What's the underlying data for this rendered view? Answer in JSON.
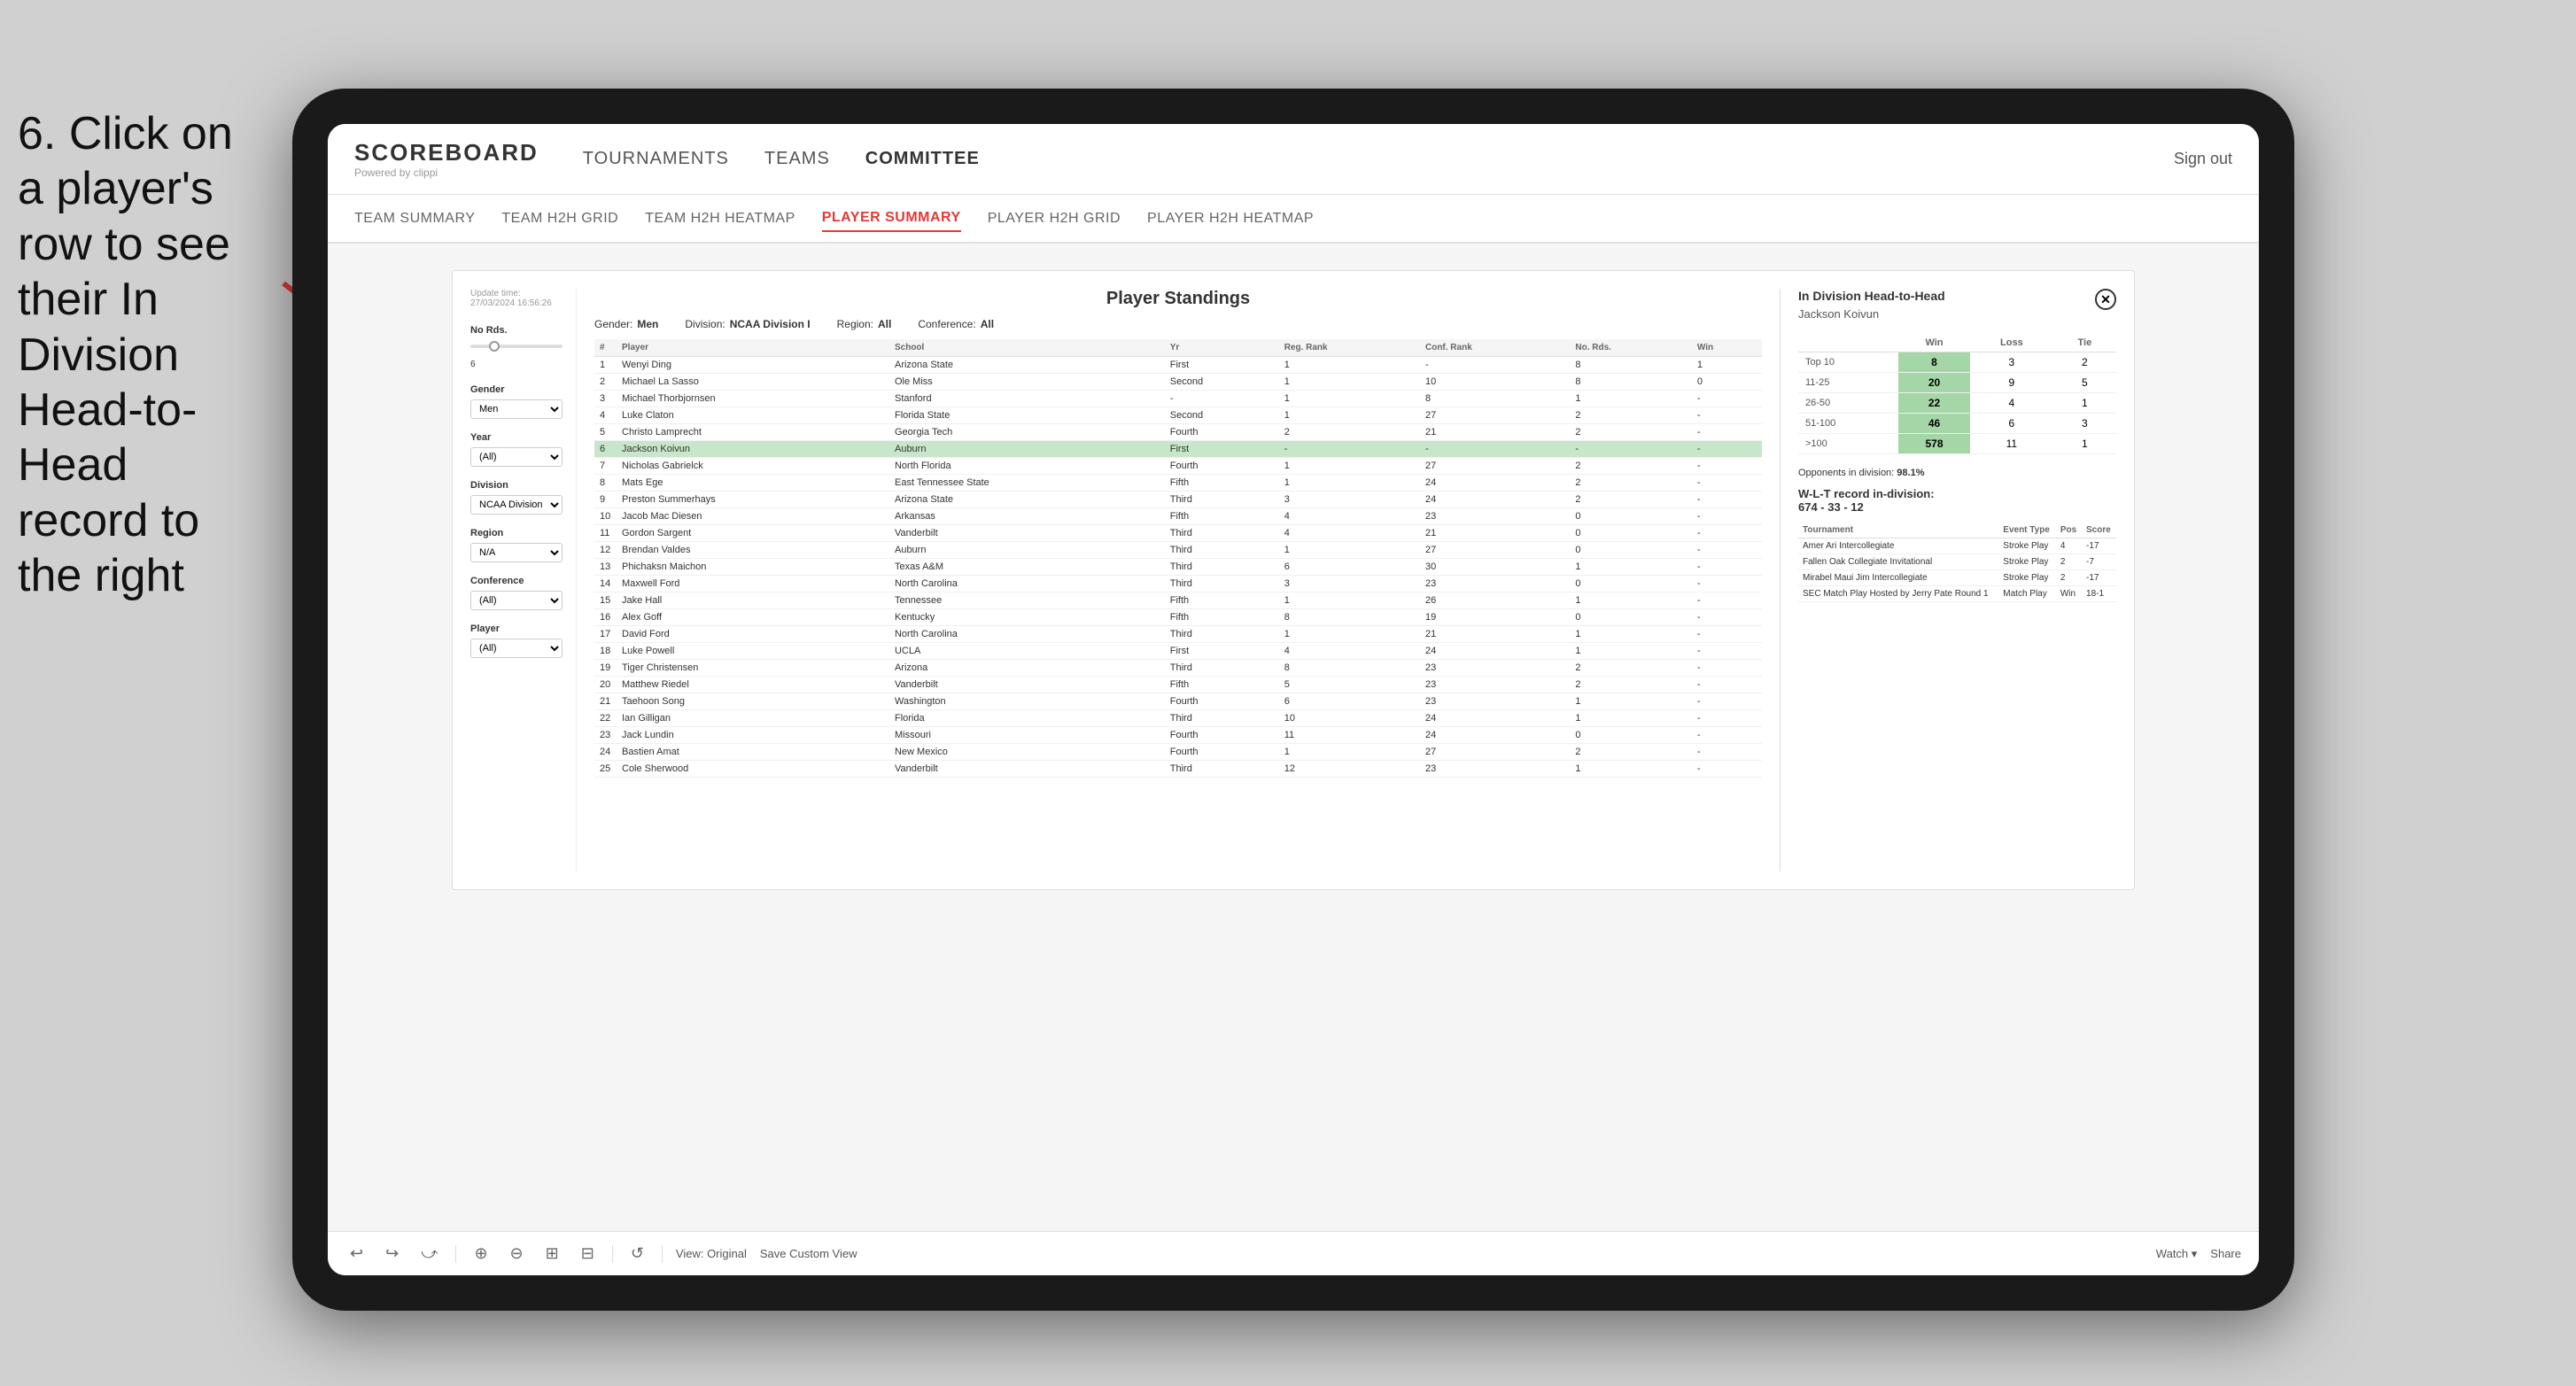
{
  "instruction": {
    "text": "6. Click on a player's row to see their In Division Head-to-Head record to the right"
  },
  "header": {
    "logo": "SCOREBOARD",
    "powered_by": "Powered by clippi",
    "nav": [
      "TOURNAMENTS",
      "TEAMS",
      "COMMITTEE"
    ],
    "sign_out": "Sign out"
  },
  "sub_nav": {
    "items": [
      "TEAM SUMMARY",
      "TEAM H2H GRID",
      "TEAM H2H HEATMAP",
      "PLAYER SUMMARY",
      "PLAYER H2H GRID",
      "PLAYER H2H HEATMAP"
    ],
    "active": "PLAYER SUMMARY"
  },
  "update_time": {
    "label": "Update time:",
    "value": "27/03/2024 16:56:26"
  },
  "filters": {
    "no_rds": {
      "label": "No Rds.",
      "value": "6"
    },
    "gender": {
      "label": "Gender",
      "value": "Men"
    },
    "year": {
      "label": "Year",
      "value": "(All)"
    },
    "division": {
      "label": "Division",
      "value": "NCAA Division I"
    },
    "region": {
      "label": "Region",
      "value": "N/A"
    },
    "conference": {
      "label": "Conference",
      "value": "(All)"
    },
    "player": {
      "label": "Player",
      "value": "(All)"
    }
  },
  "standings": {
    "title": "Player Standings",
    "gender_label": "Gender:",
    "gender_value": "Men",
    "division_label": "Division:",
    "division_value": "NCAA Division I",
    "region_label": "Region:",
    "region_value": "All",
    "conference_label": "Conference:",
    "conference_value": "All",
    "columns": [
      "#",
      "Player",
      "School",
      "Yr",
      "Reg. Rank",
      "Conf. Rank",
      "No. Rds.",
      "Win"
    ],
    "rows": [
      {
        "rank": "1",
        "player": "Wenyi Ding",
        "school": "Arizona State",
        "yr": "First",
        "reg_rank": "1",
        "conf_rank": "-",
        "no_rds": "8",
        "win": "1"
      },
      {
        "rank": "2",
        "player": "Michael La Sasso",
        "school": "Ole Miss",
        "yr": "Second",
        "reg_rank": "1",
        "conf_rank": "10",
        "no_rds": "8",
        "win": "0"
      },
      {
        "rank": "3",
        "player": "Michael Thorbjornsen",
        "school": "Stanford",
        "yr": "-",
        "reg_rank": "1",
        "conf_rank": "8",
        "no_rds": "1",
        "win": "-"
      },
      {
        "rank": "4",
        "player": "Luke Claton",
        "school": "Florida State",
        "yr": "Second",
        "reg_rank": "1",
        "conf_rank": "27",
        "no_rds": "2",
        "win": "-"
      },
      {
        "rank": "5",
        "player": "Christo Lamprecht",
        "school": "Georgia Tech",
        "yr": "Fourth",
        "reg_rank": "2",
        "conf_rank": "21",
        "no_rds": "2",
        "win": "-"
      },
      {
        "rank": "6",
        "player": "Jackson Koivun",
        "school": "Auburn",
        "yr": "First",
        "reg_rank": "-",
        "conf_rank": "-",
        "no_rds": "-",
        "win": "-",
        "highlighted": true
      },
      {
        "rank": "7",
        "player": "Nicholas Gabrielck",
        "school": "North Florida",
        "yr": "Fourth",
        "reg_rank": "1",
        "conf_rank": "27",
        "no_rds": "2",
        "win": "-"
      },
      {
        "rank": "8",
        "player": "Mats Ege",
        "school": "East Tennessee State",
        "yr": "Fifth",
        "reg_rank": "1",
        "conf_rank": "24",
        "no_rds": "2",
        "win": "-"
      },
      {
        "rank": "9",
        "player": "Preston Summerhays",
        "school": "Arizona State",
        "yr": "Third",
        "reg_rank": "3",
        "conf_rank": "24",
        "no_rds": "2",
        "win": "-"
      },
      {
        "rank": "10",
        "player": "Jacob Mac Diesen",
        "school": "Arkansas",
        "yr": "Fifth",
        "reg_rank": "4",
        "conf_rank": "23",
        "no_rds": "0",
        "win": "-"
      },
      {
        "rank": "11",
        "player": "Gordon Sargent",
        "school": "Vanderbilt",
        "yr": "Third",
        "reg_rank": "4",
        "conf_rank": "21",
        "no_rds": "0",
        "win": "-"
      },
      {
        "rank": "12",
        "player": "Brendan Valdes",
        "school": "Auburn",
        "yr": "Third",
        "reg_rank": "1",
        "conf_rank": "27",
        "no_rds": "0",
        "win": "-"
      },
      {
        "rank": "13",
        "player": "Phichaksn Maichon",
        "school": "Texas A&M",
        "yr": "Third",
        "reg_rank": "6",
        "conf_rank": "30",
        "no_rds": "1",
        "win": "-"
      },
      {
        "rank": "14",
        "player": "Maxwell Ford",
        "school": "North Carolina",
        "yr": "Third",
        "reg_rank": "3",
        "conf_rank": "23",
        "no_rds": "0",
        "win": "-"
      },
      {
        "rank": "15",
        "player": "Jake Hall",
        "school": "Tennessee",
        "yr": "Fifth",
        "reg_rank": "1",
        "conf_rank": "26",
        "no_rds": "1",
        "win": "-"
      },
      {
        "rank": "16",
        "player": "Alex Goff",
        "school": "Kentucky",
        "yr": "Fifth",
        "reg_rank": "8",
        "conf_rank": "19",
        "no_rds": "0",
        "win": "-"
      },
      {
        "rank": "17",
        "player": "David Ford",
        "school": "North Carolina",
        "yr": "Third",
        "reg_rank": "1",
        "conf_rank": "21",
        "no_rds": "1",
        "win": "-"
      },
      {
        "rank": "18",
        "player": "Luke Powell",
        "school": "UCLA",
        "yr": "First",
        "reg_rank": "4",
        "conf_rank": "24",
        "no_rds": "1",
        "win": "-"
      },
      {
        "rank": "19",
        "player": "Tiger Christensen",
        "school": "Arizona",
        "yr": "Third",
        "reg_rank": "8",
        "conf_rank": "23",
        "no_rds": "2",
        "win": "-"
      },
      {
        "rank": "20",
        "player": "Matthew Riedel",
        "school": "Vanderbilt",
        "yr": "Fifth",
        "reg_rank": "5",
        "conf_rank": "23",
        "no_rds": "2",
        "win": "-"
      },
      {
        "rank": "21",
        "player": "Taehoon Song",
        "school": "Washington",
        "yr": "Fourth",
        "reg_rank": "6",
        "conf_rank": "23",
        "no_rds": "1",
        "win": "-"
      },
      {
        "rank": "22",
        "player": "Ian Gilligan",
        "school": "Florida",
        "yr": "Third",
        "reg_rank": "10",
        "conf_rank": "24",
        "no_rds": "1",
        "win": "-"
      },
      {
        "rank": "23",
        "player": "Jack Lundin",
        "school": "Missouri",
        "yr": "Fourth",
        "reg_rank": "11",
        "conf_rank": "24",
        "no_rds": "0",
        "win": "-"
      },
      {
        "rank": "24",
        "player": "Bastien Amat",
        "school": "New Mexico",
        "yr": "Fourth",
        "reg_rank": "1",
        "conf_rank": "27",
        "no_rds": "2",
        "win": "-"
      },
      {
        "rank": "25",
        "player": "Cole Sherwood",
        "school": "Vanderbilt",
        "yr": "Third",
        "reg_rank": "12",
        "conf_rank": "23",
        "no_rds": "1",
        "win": "-"
      }
    ]
  },
  "h2h_panel": {
    "title": "In Division Head-to-Head",
    "player_name": "Jackson Koivun",
    "table_headers": [
      "",
      "Win",
      "Loss",
      "Tie"
    ],
    "rows": [
      {
        "range": "Top 10",
        "win": "8",
        "loss": "3",
        "tie": "2"
      },
      {
        "range": "11-25",
        "win": "20",
        "loss": "9",
        "tie": "5"
      },
      {
        "range": "26-50",
        "win": "22",
        "loss": "4",
        "tie": "1"
      },
      {
        "range": "51-100",
        "win": "46",
        "loss": "6",
        "tie": "3"
      },
      {
        "range": ">100",
        "win": "578",
        "loss": "11",
        "tie": "1"
      }
    ],
    "opponents_label": "Opponents in division:",
    "opponents_value": "98.1%",
    "wl_label": "W-L-T record in-division:",
    "wl_value": "674 - 33 - 12",
    "tournament_headers": [
      "Tournament",
      "Event Type",
      "Pos",
      "Score"
    ],
    "tournaments": [
      {
        "name": "Amer Ari Intercollegiate",
        "type": "Stroke Play",
        "pos": "4",
        "score": "-17"
      },
      {
        "name": "Fallen Oak Collegiate Invitational",
        "type": "Stroke Play",
        "pos": "2",
        "score": "-7"
      },
      {
        "name": "Mirabel Maui Jim Intercollegiate",
        "type": "Stroke Play",
        "pos": "2",
        "score": "-17"
      },
      {
        "name": "SEC Match Play Hosted by Jerry Pate Round 1",
        "type": "Match Play",
        "pos": "Win",
        "score": "18-1"
      }
    ]
  },
  "toolbar": {
    "buttons": [
      "↩",
      "↪",
      "⤻",
      "⊕",
      "⊖",
      "⊞",
      "⊟",
      "⊗",
      "⊘",
      "↺"
    ],
    "view_original": "View: Original",
    "save_custom": "Save Custom View",
    "watch": "Watch ▾",
    "share": "Share"
  }
}
